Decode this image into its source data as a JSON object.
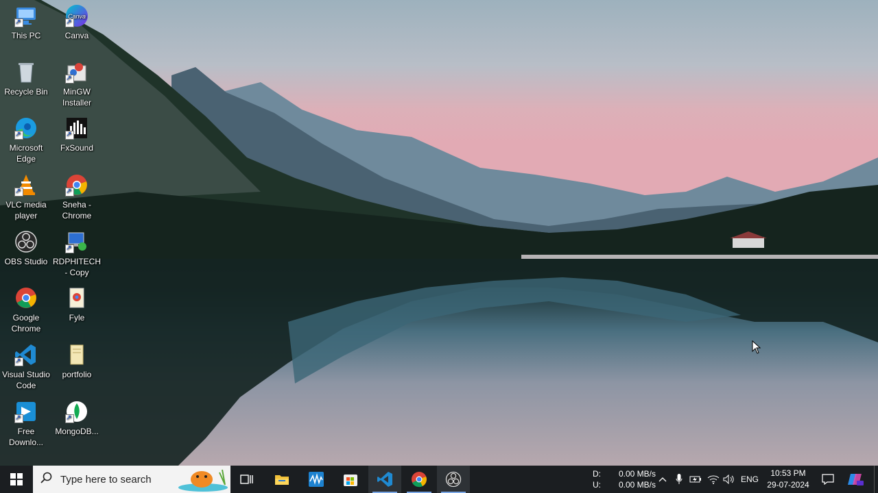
{
  "desktop": {
    "icons": [
      {
        "label": "This PC"
      },
      {
        "label": "Canva",
        "glyph": "Canva"
      },
      {
        "label": "Recycle Bin"
      },
      {
        "label": "MinGW Installer"
      },
      {
        "label": "Microsoft Edge"
      },
      {
        "label": "FxSound"
      },
      {
        "label": "VLC media player"
      },
      {
        "label": "Sneha - Chrome"
      },
      {
        "label": "OBS Studio"
      },
      {
        "label": "RDPHITECH - Copy"
      },
      {
        "label": "Google Chrome"
      },
      {
        "label": "Fyle"
      },
      {
        "label": "Visual Studio Code"
      },
      {
        "label": "portfolio"
      },
      {
        "label": "Free Downlo..."
      },
      {
        "label": "MongoDB..."
      }
    ]
  },
  "taskbar": {
    "search_placeholder": "Type here to search",
    "apps": [
      "task-view",
      "file-explorer",
      "waves-app",
      "microsoft-store",
      "visual-studio-code",
      "google-chrome",
      "obs-studio"
    ],
    "net_speed": {
      "down_label": "D:",
      "down_value": "0.00 MB/s",
      "up_label": "U:",
      "up_value": "0.00 MB/s"
    },
    "language": "ENG",
    "time": "10:53 PM",
    "date": "29-07-2024"
  },
  "colors": {
    "taskbar": "#1b1e21",
    "search_bg": "#f3f3f3",
    "vscode_blue": "#1f8ad2",
    "chrome_red": "#db4437",
    "chrome_yellow": "#f4b400",
    "chrome_green": "#0f9d58",
    "chrome_blue": "#4285f4"
  }
}
